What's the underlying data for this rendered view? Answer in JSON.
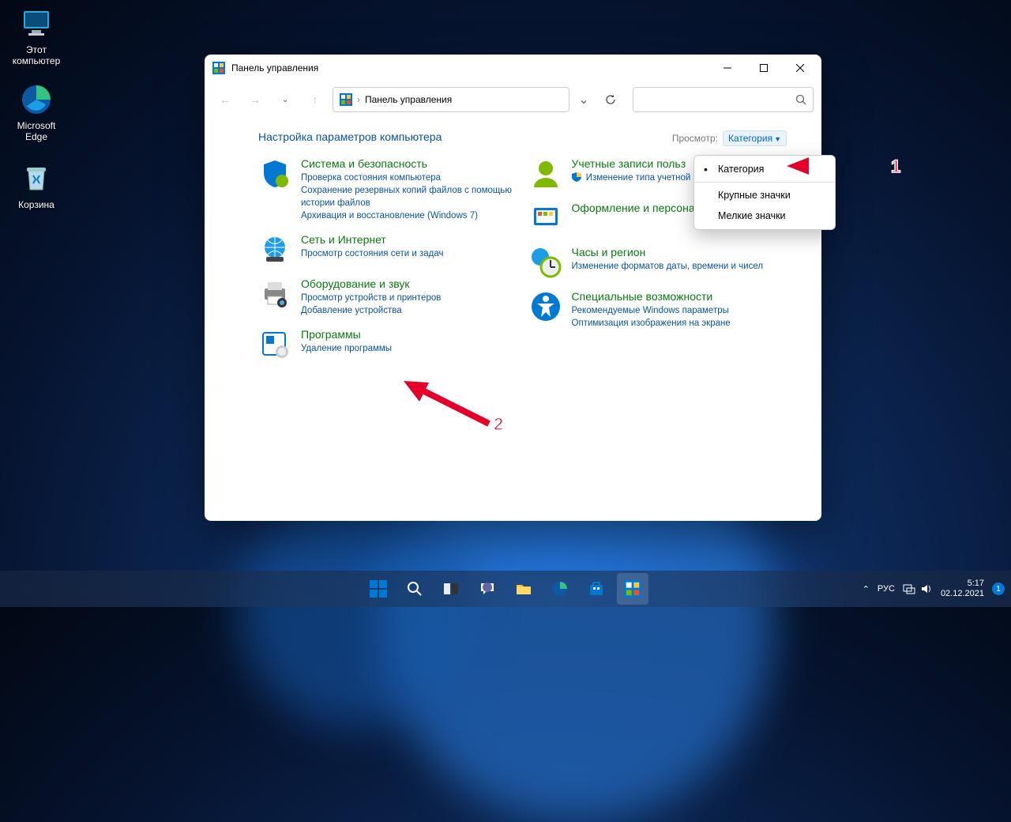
{
  "desktop": {
    "icons": [
      {
        "name": "Этот\nкомпьютер"
      },
      {
        "name": "Microsoft\nEdge"
      },
      {
        "name": "Корзина"
      }
    ]
  },
  "window": {
    "title": "Панель управления",
    "breadcrumb": "Панель управления",
    "heading": "Настройка параметров компьютера",
    "view_label": "Просмотр:",
    "view_value": "Категория"
  },
  "categories_left": [
    {
      "title": "Система и безопасность",
      "links": [
        "Проверка состояния компьютера",
        "Сохранение резервных копий файлов с помощью истории файлов",
        "Архивация и восстановление (Windows 7)"
      ]
    },
    {
      "title": "Сеть и Интернет",
      "links": [
        "Просмотр состояния сети и задач"
      ]
    },
    {
      "title": "Оборудование и звук",
      "links": [
        "Просмотр устройств и принтеров",
        "Добавление устройства"
      ]
    },
    {
      "title": "Программы",
      "links": [
        "Удаление программы"
      ]
    }
  ],
  "categories_right": [
    {
      "title": "Учетные записи польз",
      "links": [
        "Изменение типа учетной за"
      ],
      "shielded": [
        0
      ]
    },
    {
      "title": "Оформление и персонализация",
      "links": []
    },
    {
      "title": "Часы и регион",
      "links": [
        "Изменение форматов даты, времени и чисел"
      ]
    },
    {
      "title": "Специальные возможности",
      "links": [
        "Рекомендуемые Windows параметры",
        "Оптимизация изображения на экране"
      ]
    }
  ],
  "dropdown": {
    "items": [
      "Категория",
      "Крупные значки",
      "Мелкие значки"
    ],
    "selected": 0
  },
  "annotations": {
    "a1": "1",
    "a2": "2"
  },
  "taskbar": {
    "lang": "РУС",
    "time": "5:17",
    "date": "02.12.2021",
    "notif_count": "1"
  }
}
